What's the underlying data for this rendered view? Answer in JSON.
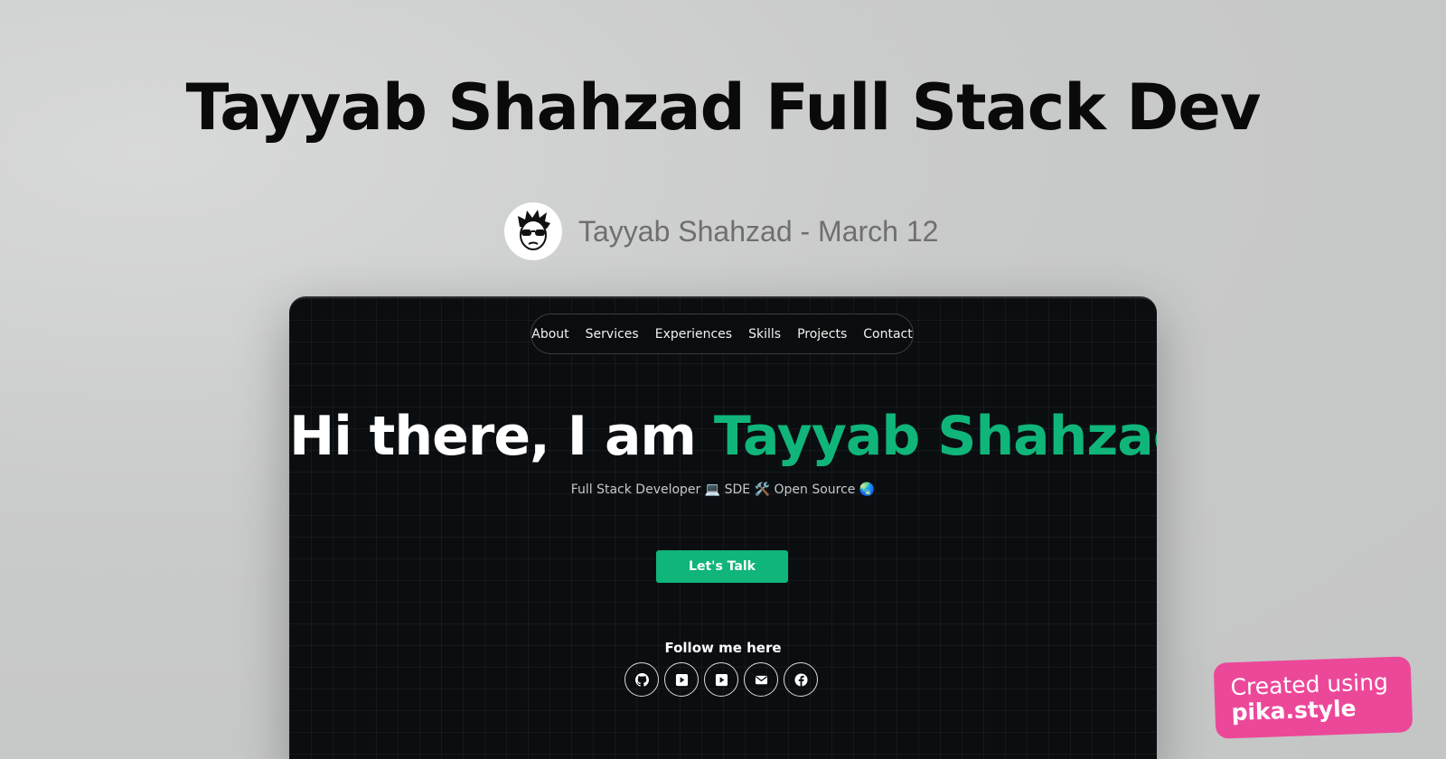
{
  "page": {
    "title": "Tayyab Shahzad Full Stack Dev",
    "byline": "Tayyab Shahzad - March 12"
  },
  "site": {
    "nav": [
      "About",
      "Services",
      "Experiences",
      "Skills",
      "Projects",
      "Contact"
    ],
    "hero": {
      "prefix": "Hi there, I am",
      "name": "Tayyab Shahzad."
    },
    "subtitle": "Full Stack Developer 💻  SDE 🛠️  Open Source 🌏",
    "cta_label": "Let's Talk",
    "follow_label": "Follow me here",
    "socials": [
      "github-icon",
      "youtube-icon",
      "youtube-icon",
      "email-icon",
      "facebook-icon"
    ]
  },
  "badge": {
    "line1": "Created using",
    "line2": "pika.style"
  },
  "colors": {
    "accent_green": "#10b57a",
    "badge_pink": "#ec4899",
    "window_bg": "#0b0e11"
  }
}
